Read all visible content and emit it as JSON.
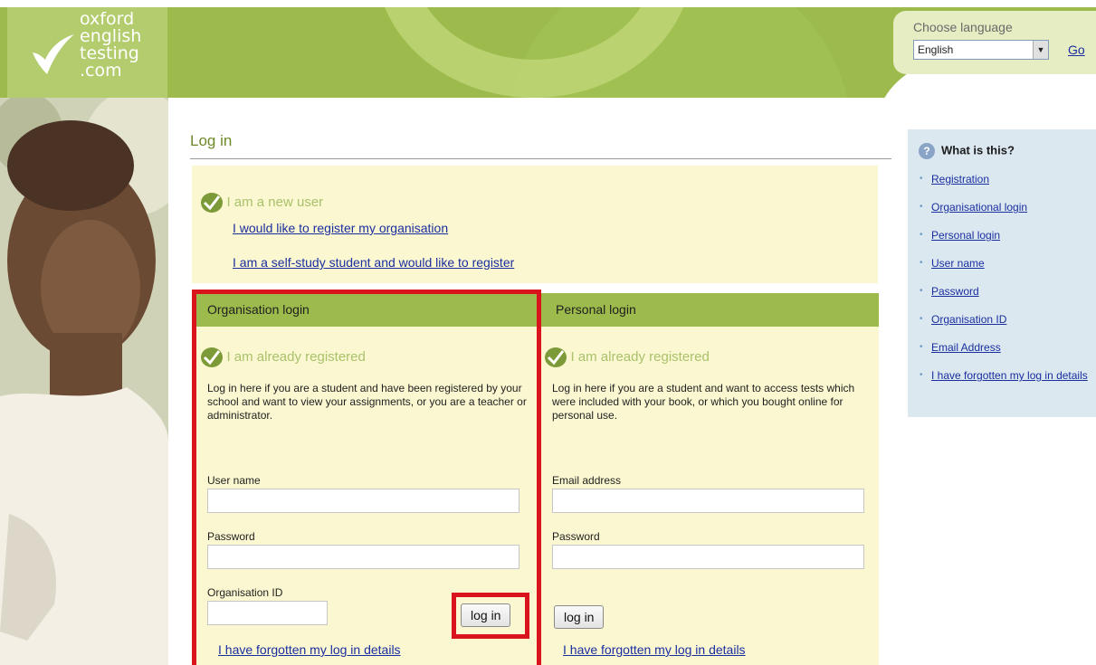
{
  "header": {
    "logo_lines": [
      "oxford",
      "english",
      "testing",
      ".com"
    ],
    "language_label": "Choose language",
    "language_selected": "English",
    "go_label": "Go"
  },
  "page": {
    "title": "Log in"
  },
  "new_user": {
    "heading": "I am a new user",
    "register_org_link": "I would like to register my organisation",
    "self_study_link": "I am a self-study student and would like to register"
  },
  "org_login": {
    "header": "Organisation login",
    "heading": "I am already registered",
    "description": "Log in here if you are a student and have been registered by your school and want to view your assignments, or you are a teacher or administrator.",
    "username_label": "User name",
    "password_label": "Password",
    "org_id_label": "Organisation ID",
    "login_button": "log in",
    "forgot_link": "I have forgotten my log in details"
  },
  "personal_login": {
    "header": "Personal login",
    "heading": "I am already registered",
    "description": "Log in here if you are a student and want to access tests which were included with your book, or which you bought online for personal use.",
    "email_label": "Email address",
    "password_label": "Password",
    "login_button": "log in",
    "forgot_link": "I have forgotten my log in details"
  },
  "help": {
    "title": "What is this?",
    "items": [
      "Registration",
      "Organisational login",
      "Personal login",
      "User name",
      "Password",
      "Organisation ID",
      "Email Address",
      "I have forgotten my log in details"
    ]
  },
  "colors": {
    "brand_green": "#9cbb4c",
    "panel_cream": "#fbf7d0",
    "highlight_red": "#d9141c",
    "link_blue": "#1a2ea0",
    "help_bg": "#dbe8f0"
  }
}
